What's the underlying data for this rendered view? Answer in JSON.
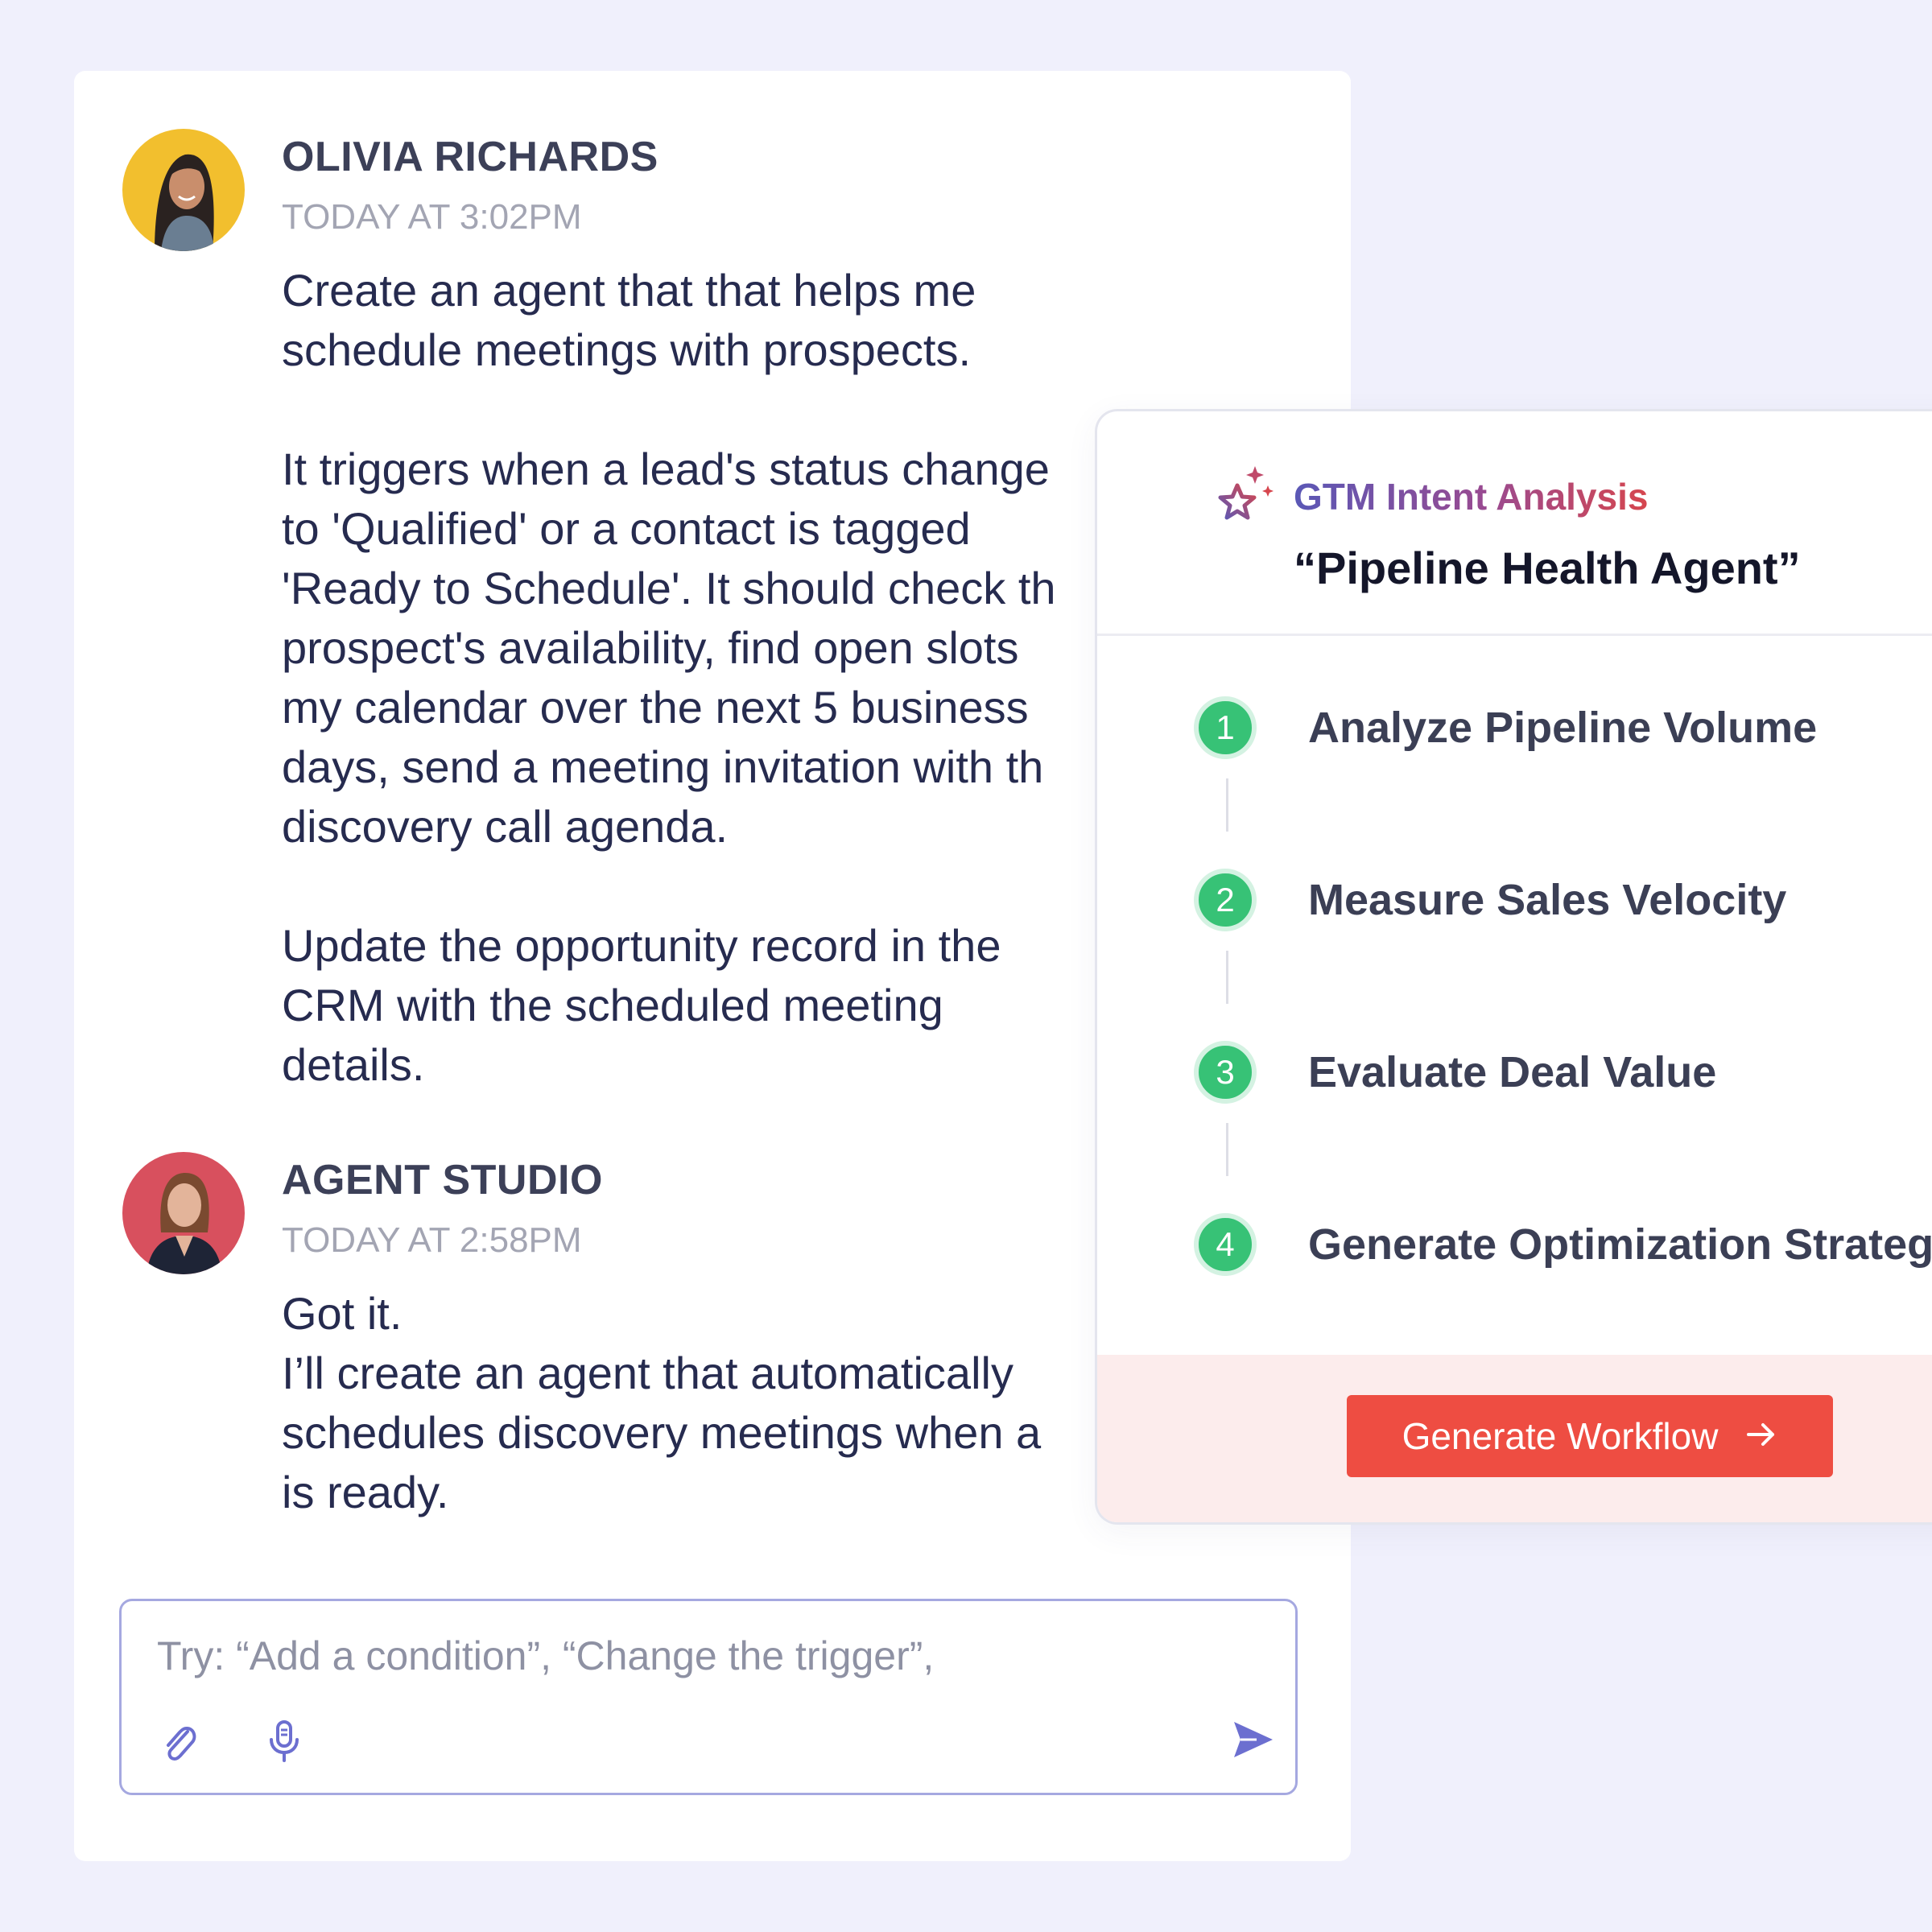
{
  "chat": {
    "messages": [
      {
        "author": "OLIVIA RICHARDS",
        "time": "TODAY AT 3:02PM",
        "text": "Create an agent that that helps me\nschedule meetings with prospects.\n\nIt triggers when a lead's status change\nto 'Qualified' or a contact is tagged\n'Ready to Schedule'. It should check th\nprospect's availability, find open slots\nmy calendar over the next 5 business\ndays, send a meeting invitation with th\ndiscovery call agenda.\n\nUpdate the opportunity record in the\nCRM with the scheduled meeting\ndetails."
      },
      {
        "author": "AGENT STUDIO",
        "time": "TODAY AT 2:58PM",
        "text": "Got it.\nI’ll create an agent that automatically\nschedules discovery meetings when a\nis ready."
      }
    ],
    "composer": {
      "placeholder": "Try: “Add a condition”, “Change the trigger”,"
    }
  },
  "workflow_card": {
    "label": "GTM Intent Analysis",
    "title": "“Pipeline Health Agent”",
    "steps": [
      {
        "number": "1",
        "label": "Analyze Pipeline Volume"
      },
      {
        "number": "2",
        "label": "Measure Sales Velocity"
      },
      {
        "number": "3",
        "label": "Evaluate Deal Value"
      },
      {
        "number": "4",
        "label": "Generate Optimization Strategy"
      }
    ],
    "button_label": "Generate Workflow"
  },
  "colors": {
    "background": "#f0f0fc",
    "accent": "#6c6fd0",
    "step_green": "#37c276",
    "button_red": "#ee4d42",
    "footer_pink": "#fcecec"
  },
  "icons": [
    "sparkle-star-icon",
    "paperclip-icon",
    "microphone-icon",
    "send-icon",
    "arrow-right-icon"
  ]
}
